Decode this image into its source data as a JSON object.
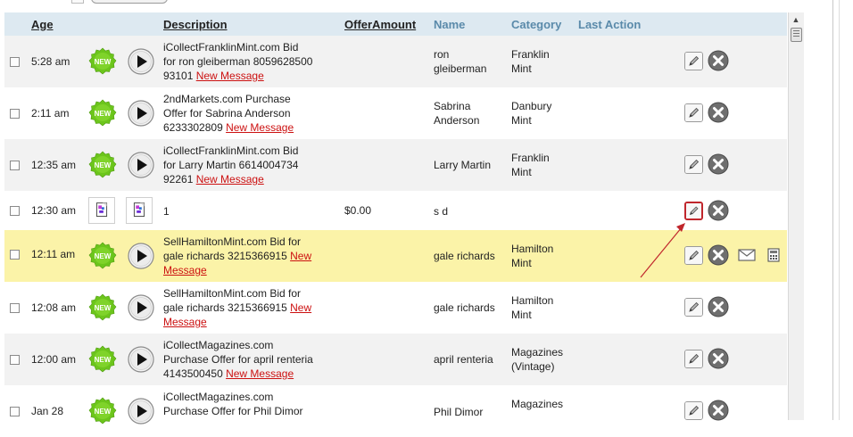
{
  "columns": {
    "age": "Age",
    "description": "Description",
    "offer_amount": "OfferAmount",
    "name": "Name",
    "category": "Category",
    "last_action": "Last Action"
  },
  "new_badge": "NEW",
  "rows": [
    {
      "age": "5:28 am",
      "desc_lines": [
        "iCollectFranklinMint.com Bid",
        "for ron gleiberman 8059628500",
        "93101"
      ],
      "message": "New Message",
      "name_lines": [
        "ron",
        "gleiberman"
      ],
      "cat_lines": [
        "Franklin",
        "Mint"
      ]
    },
    {
      "age": "2:11 am",
      "desc_lines": [
        "2ndMarkets.com Purchase",
        "Offer for Sabrina Anderson",
        "6233302809"
      ],
      "message": "New Message",
      "name_lines": [
        "Sabrina",
        "Anderson"
      ],
      "cat_lines": [
        "Danbury",
        "Mint"
      ]
    },
    {
      "age": "12:35 am",
      "desc_lines": [
        "iCollectFranklinMint.com Bid",
        "for Larry Martin 6614004734",
        "92261"
      ],
      "message": "New Message",
      "name_lines": [
        "Larry Martin"
      ],
      "cat_lines": [
        "Franklin",
        "Mint"
      ]
    },
    {
      "age": "12:30 am",
      "desc": "1",
      "amount": "$0.00",
      "name": "s d"
    },
    {
      "age": "12:11 am",
      "desc_lines": [
        "SellHamiltonMint.com Bid for",
        "gale richards 3215366915"
      ],
      "message_part1": "New",
      "message_part2": "Message",
      "name_lines": [
        "gale richards"
      ],
      "cat_lines": [
        "Hamilton",
        "Mint"
      ]
    },
    {
      "age": "12:08 am",
      "desc_lines": [
        "SellHamiltonMint.com Bid for",
        "gale richards 3215366915"
      ],
      "message_part1": "New",
      "message_part2": "Message",
      "name_lines": [
        "gale richards"
      ],
      "cat_lines": [
        "Hamilton",
        "Mint"
      ]
    },
    {
      "age": "12:00 am",
      "desc_lines": [
        "iCollectMagazines.com",
        "Purchase Offer for april renteria",
        "4143500450"
      ],
      "message": "New Message",
      "name_lines": [
        "april renteria"
      ],
      "cat_lines": [
        "Magazines",
        "(Vintage)"
      ]
    },
    {
      "age": "Jan 28",
      "desc_lines": [
        "iCollectMagazines.com",
        "Purchase Offer for Phil Dimor"
      ],
      "name_lines": [
        "Phil Dimor"
      ],
      "cat_lines": [
        "Magazines"
      ]
    }
  ],
  "colors": {
    "header_bg": "#dde9f1",
    "header_link": "#5a8aaa",
    "row_alt": "#f2f2f2",
    "row_highlight": "#fbf3a8",
    "new_message_link": "#cc1111",
    "new_badge": "#6cc51c",
    "annotation_red": "#c0262c"
  },
  "icons": {
    "new": "new-badge-icon",
    "play": "play-icon",
    "document": "document-icon",
    "edit": "pencil-icon",
    "delete": "close-icon",
    "email": "envelope-icon",
    "calculator": "calculator-icon"
  }
}
